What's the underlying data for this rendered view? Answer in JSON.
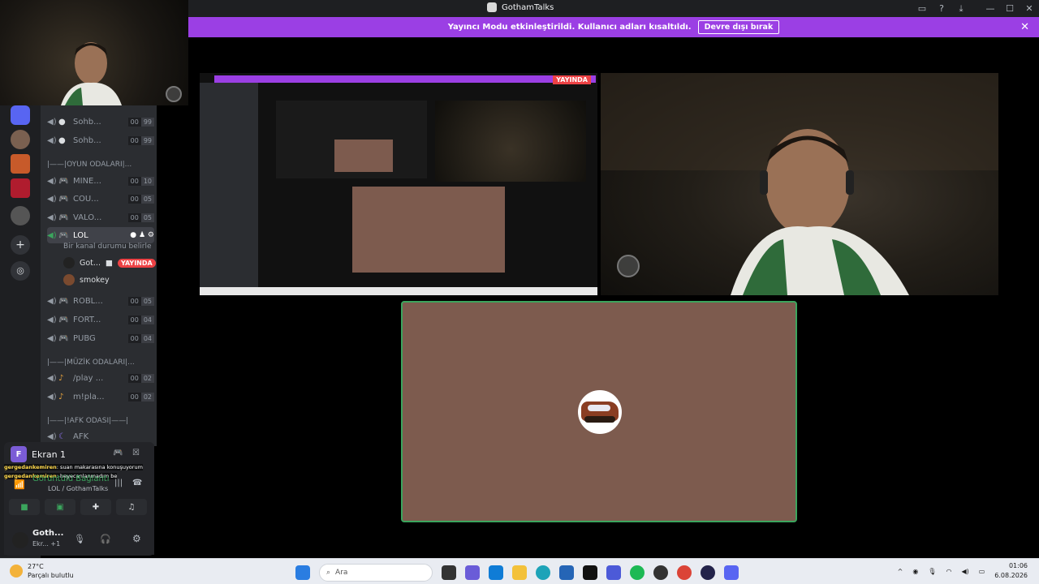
{
  "window": {
    "title": "GothamTalks",
    "controls": [
      "inbox-icon",
      "help-icon",
      "download-icon",
      "minimize-icon",
      "maximize-icon",
      "close-icon"
    ]
  },
  "banner": {
    "message": "Yayıncı Modu etkinleştirildi. Kullanıcı adları kısaltıldı.",
    "button_label": "Devre dışı bırak",
    "close": "✕"
  },
  "channels": {
    "voice": [
      {
        "name": "Sohb...",
        "a": "00",
        "b": "99"
      },
      {
        "name": "Sohb...",
        "a": "00",
        "b": "99"
      }
    ],
    "game_category": "|——|OYUN ODALARI|...",
    "games": [
      {
        "name": "MINE...",
        "a": "00",
        "b": "10"
      },
      {
        "name": "COU...",
        "a": "00",
        "b": "05"
      },
      {
        "name": "VALO...",
        "a": "00",
        "b": "05"
      }
    ],
    "active": {
      "name": "LOL",
      "status_hint": "Bir kanal durumu belirle"
    },
    "members": [
      {
        "name": "Got...",
        "badge": "YAYINDA"
      },
      {
        "name": "smokey"
      }
    ],
    "games2": [
      {
        "name": "ROBL...",
        "a": "00",
        "b": "05"
      },
      {
        "name": "FORT...",
        "a": "00",
        "b": "04"
      },
      {
        "name": "PUBG",
        "a": "00",
        "b": "04"
      }
    ],
    "music_category": "|——|MÜZİK ODALARI|...",
    "music": [
      {
        "name": "/play ...",
        "a": "00",
        "b": "02"
      },
      {
        "name": "m!pla...",
        "a": "00",
        "b": "02"
      }
    ],
    "afk_category": "|——|!AFK ODASI|——|",
    "afk": "AFK"
  },
  "panel": {
    "screen_letter": "F",
    "screen_label": "Ekran 1",
    "chat": [
      {
        "user": "gergedankemiren",
        "text": ": suan makarasına konuşuyorum"
      },
      {
        "user": "gergedankemiren",
        "text": ": heyecanlanmadım be"
      }
    ],
    "voice_status": "Görüntülü Bağlantı",
    "voice_channel": "LOL / GothamTalks",
    "user_name": "Goth...",
    "user_status": "Ekr... +1"
  },
  "stage": {
    "live_badge": "YAYINDA",
    "nested_title": "GothamTalks"
  },
  "taskbar": {
    "temperature": "27°C",
    "weather": "Parçalı bulutlu",
    "search_placeholder": "Ara",
    "time": "01:06",
    "date": "6.08.2026"
  },
  "colors": {
    "accent_purple": "#9b3fe4",
    "live_red": "#ed4245",
    "speaking_green": "#3ba55d",
    "avatar_tile": "#7d5b4e"
  }
}
